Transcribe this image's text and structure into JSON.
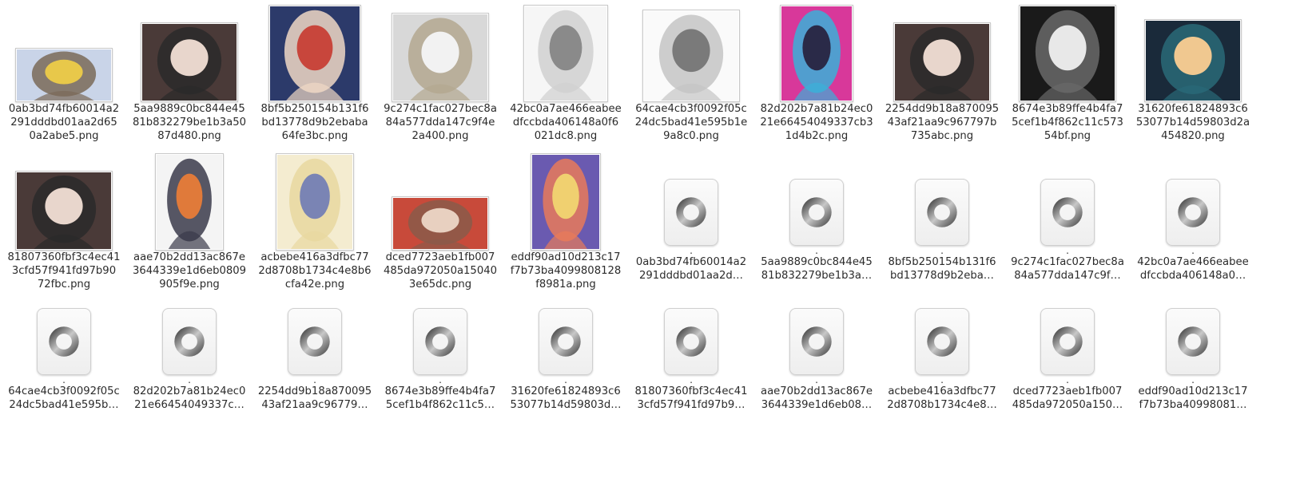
{
  "images": [
    {
      "name": "0ab3bd74fb60014a2291dddbd01aa2d650a2abe5.png",
      "line1": "0ab3bd74fb60014a2",
      "line2": "291dddbd01aa2d65",
      "line3": "0a2abe5.png",
      "thumb": "anime-girl-field-thumbnail",
      "palette": [
        "#c9d4e8",
        "#e8c84a",
        "#7a6a58"
      ]
    },
    {
      "name": "5aa9889c0bc844e4581b832279be1b3a5087d480.png",
      "line1": "5aa9889c0bc844e45",
      "line2": "81b832279be1b3a50",
      "line3": "87d480.png",
      "thumb": "anime-girl-masked-thumbnail",
      "palette": [
        "#4a3a38",
        "#e8d6cc",
        "#2a2a2a"
      ]
    },
    {
      "name": "8bf5b250154b131f6bd13778d9b2ebaba64fe3bc.png",
      "line1": "8bf5b250154b131f6",
      "line2": "bd13778d9b2ebaba",
      "line3": "64fe3bc.png",
      "thumb": "anime-girl-globe-thumbnail",
      "palette": [
        "#2c3a6a",
        "#c8463c",
        "#f0d8c4"
      ]
    },
    {
      "name": "9c274c1fac027bec8a84a577dda147c9f4e2a400.png",
      "line1": "9c274c1fac027bec8a",
      "line2": "84a577dda147c9f4e",
      "line3": "2a400.png",
      "thumb": "anime-figure-sketch-thumbnail",
      "palette": [
        "#d8d8d8",
        "#f2f2f2",
        "#b4a890"
      ]
    },
    {
      "name": "42bc0a7ae466eabeedfccbda406148a0f6021dc8.png",
      "line1": "42bc0a7ae466eabee",
      "line2": "dfccbda406148a0f6",
      "line3": "021dc8.png",
      "thumb": "anime-girl-lineart-thumbnail",
      "palette": [
        "#f6f6f6",
        "#8a8a8a",
        "#d0d0d0"
      ]
    },
    {
      "name": "64cae4cb3f0092f05c24dc5bad41e595b1e9a8c0.png",
      "line1": "64cae4cb3f0092f05c",
      "line2": "24dc5bad41e595b1e",
      "line3": "9a8c0.png",
      "thumb": "anime-girl-dragon-sketch-thumbnail",
      "palette": [
        "#fafafa",
        "#7a7a7a",
        "#c4c4c4"
      ]
    },
    {
      "name": "82d202b7a81b24ec021e66454049337cb31d4b2c.png",
      "line1": "82d202b7a81b24ec0",
      "line2": "21e66454049337cb3",
      "line3": "1d4b2c.png",
      "thumb": "anime-boy-neon-thumbnail",
      "palette": [
        "#d8389a",
        "#2a2a48",
        "#3ab0d8"
      ]
    },
    {
      "name": "2254dd9b18a87009543af21aa9c967797b735abc.png",
      "line1": "2254dd9b18a870095",
      "line2": "43af21aa9c967797b",
      "line3": "735abc.png",
      "thumb": "anime-girl-glasses-thumbnail",
      "palette": [
        "#4a3a38",
        "#e8d6cc",
        "#2a2a2a"
      ]
    },
    {
      "name": "8674e3b89ffe4b4fa75cef1b4f862c11c57354bf.png",
      "line1": "8674e3b89ffe4b4fa7",
      "line2": "5cef1b4f862c11c573",
      "line3": "54bf.png",
      "thumb": "anime-monochrome-thumbnail",
      "palette": [
        "#1a1a1a",
        "#e8e8e8",
        "#6a6a6a"
      ]
    },
    {
      "name": "31620fe61824893c653077b14d59803d2a454820.png",
      "line1": "31620fe61824893c6",
      "line2": "53077b14d59803d2a",
      "line3": "454820.png",
      "thumb": "anime-girl-night-thumbnail",
      "palette": [
        "#1a2a3a",
        "#f0c890",
        "#2a6a78"
      ]
    },
    {
      "name": "81807360fbf3c4ec413cfd57f941fd97b9072fbc.png",
      "line1": "81807360fbf3c4ec41",
      "line2": "3cfd57f941fd97b90",
      "line3": "72fbc.png",
      "thumb": "anime-girl-masked-2-thumbnail",
      "palette": [
        "#4a3a38",
        "#e8d6cc",
        "#2a2a2a"
      ]
    },
    {
      "name": "aae70b2dd13ac867e3644339e1d6eb0809905f9e.png",
      "line1": "aae70b2dd13ac867e",
      "line2": "3644339e1d6eb0809",
      "line3": "905f9e.png",
      "thumb": "anime-fox-girl-thumbnail",
      "palette": [
        "#f4f4f4",
        "#e07a3a",
        "#3a3a4a"
      ]
    },
    {
      "name": "acbebe416a3dfbc772d8708b1734c4e8b6cfa42e.png",
      "line1": "acbebe416a3dfbc77",
      "line2": "2d8708b1734c4e8b6",
      "line3": "cfa42e.png",
      "thumb": "anime-fox-lady-thumbnail",
      "palette": [
        "#f4ecd0",
        "#7a84b4",
        "#e8d8a0"
      ]
    },
    {
      "name": "dced7723aeb1fb007485da972050a150403e65dc.png",
      "line1": "dced7723aeb1fb007",
      "line2": "485da972050a15040",
      "line3": "3e65dc.png",
      "thumb": "anime-red-scene-thumbnail",
      "palette": [
        "#c84a3a",
        "#e8d0c0",
        "#8a5a4a"
      ]
    },
    {
      "name": "eddf90ad10d213c17f7b73ba4099808128f8981a.png",
      "line1": "eddf90ad10d213c17",
      "line2": "f7b73ba4099808128",
      "line3": "f8981a.png",
      "thumb": "anime-idol-stage-thumbnail",
      "palette": [
        "#6a5ab0",
        "#f0d070",
        "#e87a5a"
      ]
    }
  ],
  "json_files": [
    {
      "dot": ".",
      "line1": "0ab3bd74fb60014a2",
      "line2": "291dddbd01aa2d…"
    },
    {
      "dot": ".",
      "line1": "5aa9889c0bc844e45",
      "line2": "81b832279be1b3a…"
    },
    {
      "dot": ".",
      "line1": "8bf5b250154b131f6",
      "line2": "bd13778d9b2eba…"
    },
    {
      "dot": ".",
      "line1": "9c274c1fac027bec8a",
      "line2": "84a577dda147c9f…"
    },
    {
      "dot": ".",
      "line1": "42bc0a7ae466eabee",
      "line2": "dfccbda406148a0…"
    },
    {
      "dot": ".",
      "line1": "64cae4cb3f0092f05c",
      "line2": "24dc5bad41e595b…"
    },
    {
      "dot": ".",
      "line1": "82d202b7a81b24ec0",
      "line2": "21e66454049337c…"
    },
    {
      "dot": ".",
      "line1": "2254dd9b18a870095",
      "line2": "43af21aa9c96779…"
    },
    {
      "dot": ".",
      "line1": "8674e3b89ffe4b4fa7",
      "line2": "5cef1b4f862c11c5…"
    },
    {
      "dot": ".",
      "line1": "31620fe61824893c6",
      "line2": "53077b14d59803d…"
    },
    {
      "dot": ".",
      "line1": "81807360fbf3c4ec41",
      "line2": "3cfd57f941fd97b9…"
    },
    {
      "dot": ".",
      "line1": "aae70b2dd13ac867e",
      "line2": "3644339e1d6eb08…"
    },
    {
      "dot": ".",
      "line1": "acbebe416a3dfbc77",
      "line2": "2d8708b1734c4e8…"
    },
    {
      "dot": ".",
      "line1": "dced7723aeb1fb007",
      "line2": "485da972050a150…"
    },
    {
      "dot": ".",
      "line1": "eddf90ad10d213c17",
      "line2": "f7b73ba40998081…"
    }
  ],
  "json_icon": "json-file-icon",
  "colors": {
    "selection_accent": "#e95420",
    "text": "#2b2b2b",
    "background": "#ffffff"
  }
}
